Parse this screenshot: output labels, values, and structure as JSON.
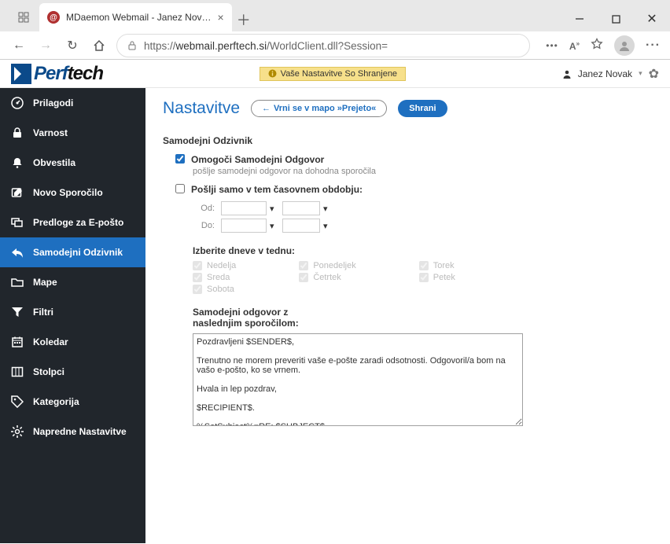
{
  "browser": {
    "tab_title": "MDaemon Webmail - Janez Nov…",
    "url_prefix": "https://",
    "url_host": "webmail.perftech.si",
    "url_path": "/WorldClient.dll?Session="
  },
  "topbar": {
    "logo_part1": "Perf",
    "logo_part2": "tech",
    "saved_notice": "Vaše Nastavitve So Shranjene",
    "user_name": "Janez Novak"
  },
  "sidebar": {
    "items": [
      {
        "label": "Prilagodi"
      },
      {
        "label": "Varnost"
      },
      {
        "label": "Obvestila"
      },
      {
        "label": "Novo Sporočilo"
      },
      {
        "label": "Predloge za E-pošto"
      },
      {
        "label": "Samodejni Odzivnik"
      },
      {
        "label": "Mape"
      },
      {
        "label": "Filtri"
      },
      {
        "label": "Koledar"
      },
      {
        "label": "Stolpci"
      },
      {
        "label": "Kategorija"
      },
      {
        "label": "Napredne Nastavitve"
      }
    ]
  },
  "header": {
    "title": "Nastavitve",
    "back_label": "Vrni se v mapo »Prejeto«",
    "save_label": "Shrani"
  },
  "form": {
    "section_title": "Samodejni Odzivnik",
    "enable_label": "Omogoči Samodejni Odgovor",
    "enable_hint": "pošlje samodejni odgovor na dohodna sporočila",
    "range_label": "Pošlji samo v tem časovnem obdobju:",
    "from_label": "Od:",
    "to_label": "Do:",
    "days_label": "Izberite dneve v tednu:",
    "days": {
      "sun": "Nedelja",
      "mon": "Ponedeljek",
      "tue": "Torek",
      "wed": "Sreda",
      "thu": "Četrtek",
      "fri": "Petek",
      "sat": "Sobota"
    },
    "msg_label": "Samodejni odgovor z naslednjim sporočilom:",
    "msg_value": "Pozdravljeni $SENDER$,\n\nTrenutno ne morem preveriti vaše e-pošte zaradi odsotnosti. Odgovoril/a bom na vašo e-pošto, ko se vrnem.\n\nHvala in lep pozdrav,\n\n$RECIPIENT$.\n\n%SetSubject%=RE: $SUBJECT$"
  },
  "colors": {
    "accent": "#1e6fc0",
    "sidebar_bg": "#21262c"
  }
}
